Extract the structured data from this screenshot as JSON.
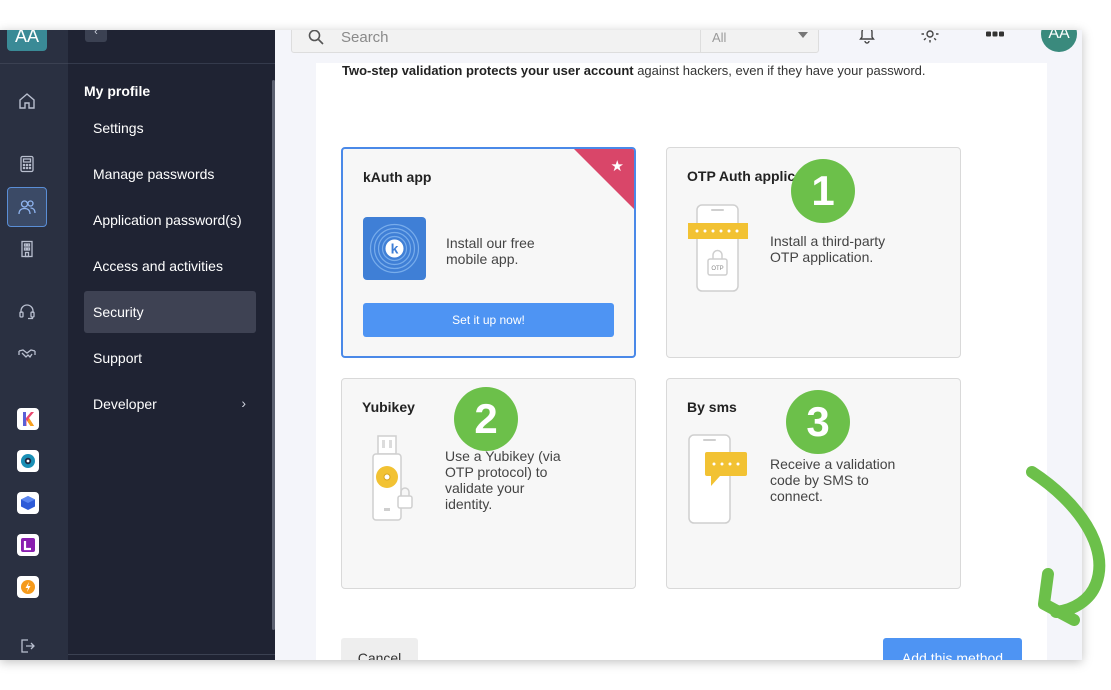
{
  "user": {
    "initials": "AA"
  },
  "colors": {
    "accent": "#4e94f3",
    "selected_border": "#4a89e8",
    "ribbon": "#d94669",
    "badge": "#6cc04a",
    "sidebar": "#1f2333",
    "rail": "#2a3041"
  },
  "header": {
    "search_placeholder": "Search",
    "search_filter": "All",
    "icons": [
      "bell-icon",
      "gear-icon",
      "apps-grid-icon"
    ]
  },
  "rail": {
    "icons": [
      "home-icon",
      "calculator-icon",
      "users-icon",
      "building-icon",
      "headset-icon",
      "handshake-icon"
    ],
    "apps": [
      "kdrive-app-icon",
      "kchat-app-icon",
      "cube-app-icon",
      "kmeet-app-icon",
      "power-app-icon"
    ],
    "bottom_icon": "logout-icon"
  },
  "menu": {
    "title": "My profile",
    "items": [
      {
        "label": "Settings"
      },
      {
        "label": "Manage passwords"
      },
      {
        "label": "Application password(s)"
      },
      {
        "label": "Access and activities"
      },
      {
        "label": "Security",
        "active": true
      },
      {
        "label": "Support"
      },
      {
        "label": "Developer",
        "has_submenu": true
      }
    ]
  },
  "main": {
    "intro_bold": "Two-step validation protects your user account",
    "intro_rest": " against hackers, even if they have your password.",
    "methods": [
      {
        "title": "kAuth app",
        "description": [
          "Install our free",
          "mobile app."
        ],
        "button": "Set it up now!",
        "selected": true,
        "recommended": true,
        "logo_letter": "k"
      },
      {
        "title": "OTP Auth application",
        "description": [
          "Install a third-party",
          "OTP application."
        ],
        "badge": "1",
        "icon": "phone-otp-icon",
        "icon_label": "OTP"
      },
      {
        "title": "Yubikey",
        "description": [
          "Use a Yubikey (via",
          "OTP protocol) to",
          "validate your",
          "identity."
        ],
        "badge": "2",
        "icon": "usb-key-icon"
      },
      {
        "title": "By sms",
        "description": [
          "Receive a validation",
          "code by SMS to",
          "connect."
        ],
        "badge": "3",
        "icon": "phone-sms-icon"
      }
    ],
    "cancel_label": "Cancel",
    "add_label": "Add this method"
  }
}
